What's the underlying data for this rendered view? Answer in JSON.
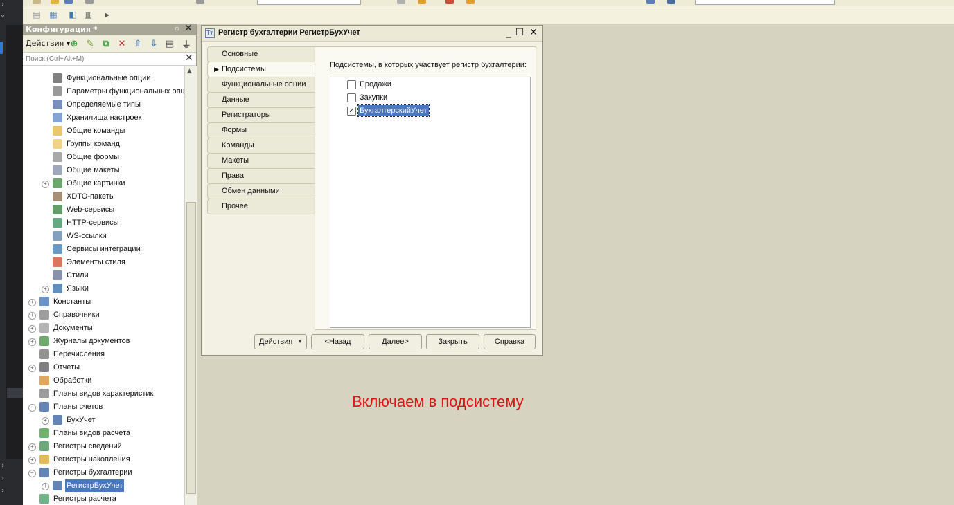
{
  "config_panel": {
    "title": "Конфигурация *",
    "actions_label": "Действия",
    "search_placeholder": "Поиск (Ctrl+Alt+M)",
    "tree": [
      {
        "label": "Функциональные опции",
        "icon": "options-icon",
        "expander": "",
        "selected": false,
        "color": "#555555"
      },
      {
        "label": "Параметры функциональных опц",
        "icon": "params-icon",
        "expander": "",
        "selected": false,
        "color": "#777777"
      },
      {
        "label": "Определяемые типы",
        "icon": "types-icon",
        "expander": "",
        "selected": false,
        "color": "#4f6aa8"
      },
      {
        "label": "Хранилища настроек",
        "icon": "storage-icon",
        "expander": "",
        "selected": false,
        "color": "#5a86c6"
      },
      {
        "label": "Общие команды",
        "icon": "command-icon",
        "expander": "",
        "selected": false,
        "color": "#e1b43a"
      },
      {
        "label": "Группы команд",
        "icon": "command-group-icon",
        "expander": "",
        "selected": false,
        "color": "#e8c35c"
      },
      {
        "label": "Общие формы",
        "icon": "form-icon",
        "expander": "",
        "selected": false,
        "color": "#8c8c8c"
      },
      {
        "label": "Общие макеты",
        "icon": "template-icon",
        "expander": "",
        "selected": false,
        "color": "#7d8ba3"
      },
      {
        "label": "Общие картинки",
        "icon": "picture-icon",
        "expander": "⊕",
        "selected": false,
        "color": "#3b8a3b"
      },
      {
        "label": "XDTO-пакеты",
        "icon": "xdto-icon",
        "expander": "",
        "selected": false,
        "color": "#8a6a4a"
      },
      {
        "label": "Web-сервисы",
        "icon": "web-service-icon",
        "expander": "",
        "selected": false,
        "color": "#2f7d3a"
      },
      {
        "label": "HTTP-сервисы",
        "icon": "http-service-icon",
        "expander": "",
        "selected": false,
        "color": "#2f8d5a"
      },
      {
        "label": "WS-ссылки",
        "icon": "ws-link-icon",
        "expander": "",
        "selected": false,
        "color": "#5c7fa8"
      },
      {
        "label": "Сервисы интеграции",
        "icon": "integration-icon",
        "expander": "",
        "selected": false,
        "color": "#3a78b0"
      },
      {
        "label": "Элементы стиля",
        "icon": "style-element-icon",
        "expander": "",
        "selected": false,
        "color": "#d04a2a"
      },
      {
        "label": "Стили",
        "icon": "style-icon",
        "expander": "",
        "selected": false,
        "color": "#5d6f8f"
      },
      {
        "label": "Языки",
        "icon": "language-icon",
        "expander": "⊕",
        "selected": false,
        "color": "#2c6aa8"
      },
      {
        "label": "Константы",
        "icon": "constant-icon",
        "expander": "⊕",
        "selected": false,
        "color": "#3b6fb5"
      },
      {
        "label": "Справочники",
        "icon": "catalog-icon",
        "expander": "⊕",
        "selected": false,
        "color": "#7d7d7d"
      },
      {
        "label": "Документы",
        "icon": "document-icon",
        "expander": "⊕",
        "selected": false,
        "color": "#9a9a9a"
      },
      {
        "label": "Журналы документов",
        "icon": "journal-icon",
        "expander": "⊕",
        "selected": false,
        "color": "#3e8c3e"
      },
      {
        "label": "Перечисления",
        "icon": "enum-icon",
        "expander": "",
        "selected": false,
        "color": "#6f6f6f"
      },
      {
        "label": "Отчеты",
        "icon": "report-icon",
        "expander": "⊕",
        "selected": false,
        "color": "#555555"
      },
      {
        "label": "Обработки",
        "icon": "processing-icon",
        "expander": "",
        "selected": false,
        "color": "#d88a2a"
      },
      {
        "label": "Планы видов характеристик",
        "icon": "chart-char-icon",
        "expander": "",
        "selected": false,
        "color": "#7b7b7b"
      },
      {
        "label": "Планы счетов",
        "icon": "chart-accounts-icon",
        "expander": "⊖",
        "selected": false,
        "color": "#2f5b9c"
      },
      {
        "label": "БухУчет",
        "icon": "chart-accounts-item-icon",
        "expander": "⊕",
        "selected": false,
        "color": "#2f5b9c"
      },
      {
        "label": "Планы видов расчета",
        "icon": "calc-types-icon",
        "expander": "",
        "selected": false,
        "color": "#3f9a3f"
      },
      {
        "label": "Регистры сведений",
        "icon": "info-register-icon",
        "expander": "⊕",
        "selected": false,
        "color": "#3d8a4d"
      },
      {
        "label": "Регистры накопления",
        "icon": "accum-register-icon",
        "expander": "⊕",
        "selected": false,
        "color": "#d6a22a"
      },
      {
        "label": "Регистры бухгалтерии",
        "icon": "acc-register-icon",
        "expander": "⊖",
        "selected": false,
        "color": "#2f5b9c"
      },
      {
        "label": "РегистрБухУчет",
        "icon": "acc-register-item-icon",
        "expander": "⊕",
        "selected": true,
        "color": "#2f5b9c"
      },
      {
        "label": "Регистры расчета",
        "icon": "calc-register-icon",
        "expander": "",
        "selected": false,
        "color": "#3f9a5f"
      }
    ]
  },
  "dialog": {
    "title": "Регистр бухгалтерии РегистрБухУчет",
    "tabs": [
      {
        "label": "Основные",
        "active": false
      },
      {
        "label": "Подсистемы",
        "active": true
      },
      {
        "label": "Функциональные опции",
        "active": false
      },
      {
        "label": "Данные",
        "active": false
      },
      {
        "label": "Регистраторы",
        "active": false
      },
      {
        "label": "Формы",
        "active": false
      },
      {
        "label": "Команды",
        "active": false
      },
      {
        "label": "Макеты",
        "active": false
      },
      {
        "label": "Права",
        "active": false
      },
      {
        "label": "Обмен данными",
        "active": false
      },
      {
        "label": "Прочее",
        "active": false
      }
    ],
    "subsystems_caption": "Подсистемы, в которых участвует регистр бухгалтерии:",
    "subsystems": [
      {
        "label": "Продажи",
        "checked": false,
        "selected": false
      },
      {
        "label": "Закупки",
        "checked": false,
        "selected": false
      },
      {
        "label": "БухгалтерскийУчет",
        "checked": true,
        "selected": true
      }
    ],
    "buttons": {
      "actions": "Действия",
      "back": "<Назад",
      "next": "Далее>",
      "close": "Закрыть",
      "help": "Справка"
    }
  },
  "annotation": "Включаем в подсистему",
  "colors": {
    "annotation": "#e01111",
    "selection": "#4a78c0",
    "desktop": "#d6d3c1"
  }
}
